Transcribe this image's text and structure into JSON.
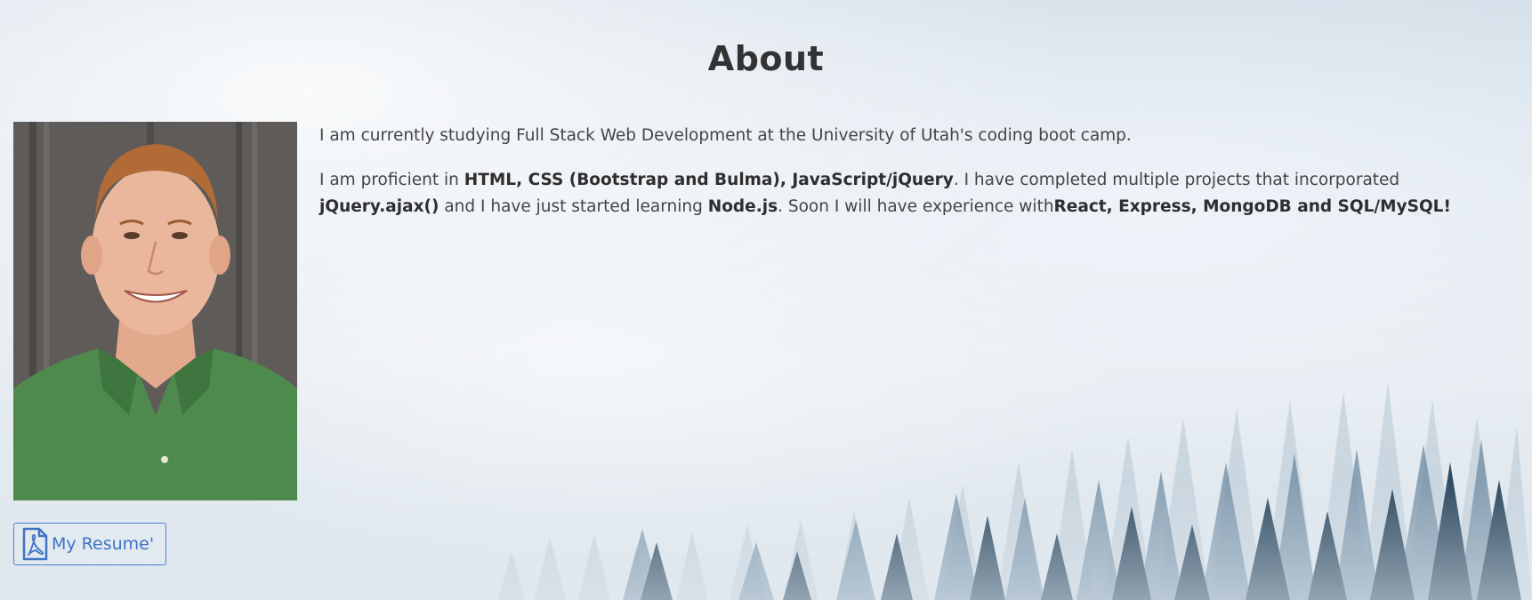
{
  "title": "About",
  "paragraphs": {
    "p1": "I am currently studying Full Stack Web Development at the University of Utah's coding boot camp.",
    "p2": {
      "t1": "I am proficient in ",
      "b1": "HTML, CSS (Bootstrap and Bulma), JavaScript/jQuery",
      "t2": ". I have completed multiple projects that incorporated ",
      "b2": "jQuery.ajax()",
      "t3": " and I have just started learning ",
      "b3": "Node.js",
      "t4": ". Soon I will have experience with",
      "b4": "React, Express, MongoDB and SQL/MySQL!"
    }
  },
  "resume_button": {
    "label": "My Resume'",
    "icon": "pdf-file-icon"
  },
  "photo": {
    "icon": "profile-photo"
  },
  "colors": {
    "accent": "#3f73c8",
    "shirt": "#4e8a4e",
    "text": "#444444"
  }
}
